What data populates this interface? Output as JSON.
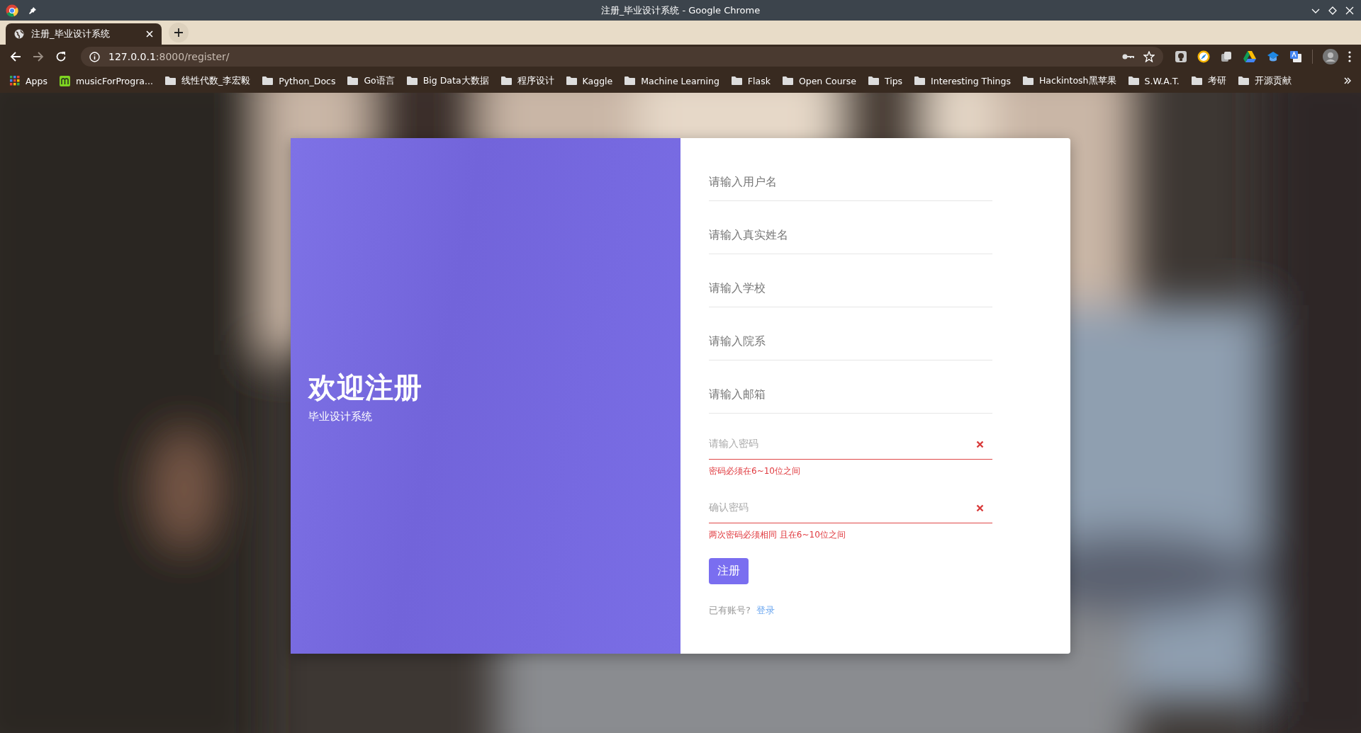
{
  "browser": {
    "window_title": "注册_毕业设计系统 - Google Chrome",
    "tabs": [
      {
        "title": "注册_毕业设计系统",
        "selected": true
      }
    ],
    "address": {
      "host": "127.0.0.1",
      "rest": ":8000/register/"
    },
    "bookmarks": [
      {
        "label": "Apps",
        "kind": "apps"
      },
      {
        "label": "musicForProgra...",
        "kind": "site"
      },
      {
        "label": "线性代数_李宏毅",
        "kind": "folder"
      },
      {
        "label": "Python_Docs",
        "kind": "folder"
      },
      {
        "label": "Go语言",
        "kind": "folder"
      },
      {
        "label": "Big Data大数据",
        "kind": "folder"
      },
      {
        "label": "程序设计",
        "kind": "folder"
      },
      {
        "label": "Kaggle",
        "kind": "folder"
      },
      {
        "label": "Machine Learning",
        "kind": "folder"
      },
      {
        "label": "Flask",
        "kind": "folder"
      },
      {
        "label": "Open Course",
        "kind": "folder"
      },
      {
        "label": "Tips",
        "kind": "folder"
      },
      {
        "label": "Interesting Things",
        "kind": "folder"
      },
      {
        "label": "Hackintosh黑苹果",
        "kind": "folder"
      },
      {
        "label": "S.W.A.T.",
        "kind": "folder"
      },
      {
        "label": "考研",
        "kind": "folder"
      },
      {
        "label": "开源贡献",
        "kind": "folder"
      }
    ]
  },
  "page": {
    "welcome": {
      "title": "欢迎注册",
      "subtitle": "毕业设计系统"
    },
    "fields": [
      {
        "placeholder": "请输入用户名",
        "invalid": false
      },
      {
        "placeholder": "请输入真实姓名",
        "invalid": false
      },
      {
        "placeholder": "请输入学校",
        "invalid": false
      },
      {
        "placeholder": "请输入院系",
        "invalid": false
      },
      {
        "placeholder": "请输入邮箱",
        "invalid": false
      },
      {
        "placeholder": "请输入密码",
        "invalid": true,
        "error": "密码必须在6~10位之间"
      },
      {
        "placeholder": "确认密码",
        "invalid": true,
        "error": "两次密码必须相同 且在6~10位之间"
      }
    ],
    "submit": "注册",
    "login_prompt": {
      "text": "已有账号?",
      "link": "登录"
    }
  }
}
